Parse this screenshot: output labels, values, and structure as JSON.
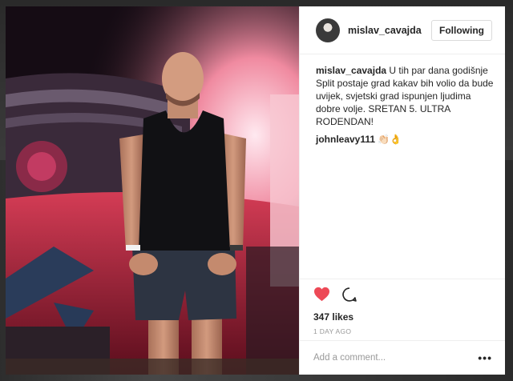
{
  "post": {
    "username": "mislav_cavajda",
    "follow_label": "Following",
    "caption_author": "mislav_cavajda",
    "caption_text": "U tih par dana godišnje Split postaje grad kakav bih volio da bude uvijek, svjetski grad ispunjen ljudima dobre volje. SRETAN 5. ULTRA RODENDAN!",
    "comments": [
      {
        "author": "johnleavy111",
        "text": "👏🏻👌"
      }
    ],
    "likes": "347 likes",
    "date": "1 DAY AGO",
    "add_comment_placeholder": "Add a comment...",
    "more_label": "•••"
  },
  "icons": {
    "like": "heart-icon",
    "comment": "comment-bubble-icon",
    "more": "more-options-icon"
  },
  "colors": {
    "heart": "#ed4956",
    "text": "#262626",
    "muted": "#999999"
  }
}
